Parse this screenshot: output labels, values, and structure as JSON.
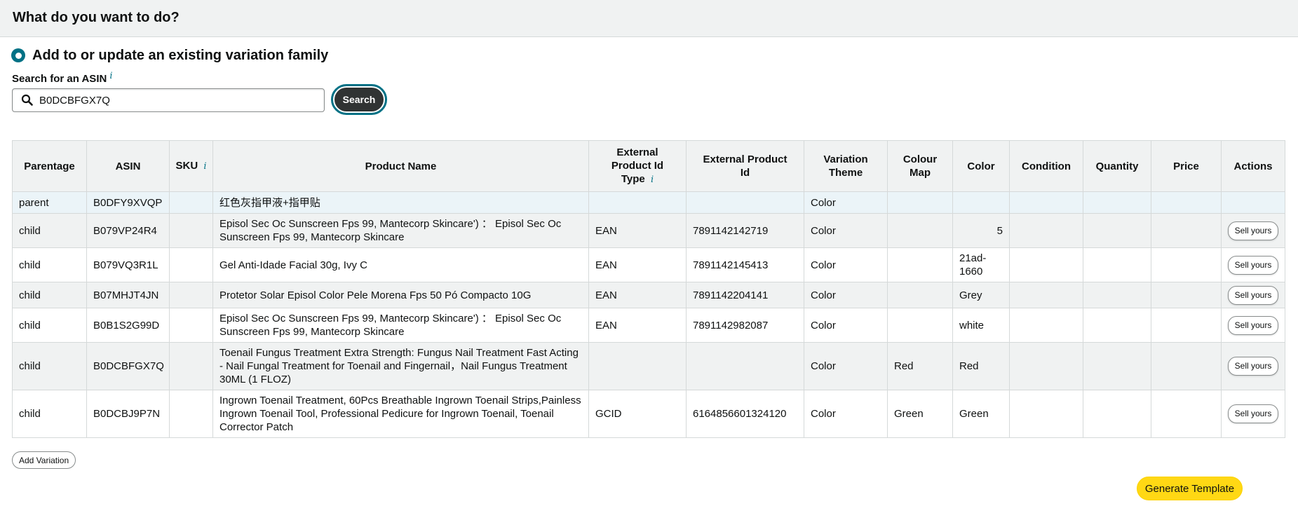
{
  "header": {
    "title": "What do you want to do?"
  },
  "option": {
    "label": "Add to or update an existing variation family",
    "selected": true
  },
  "search": {
    "label": "Search for an ASIN",
    "info_icon": "i",
    "value": "B0DCBFGX7Q",
    "button_label": "Search",
    "icon": "search-icon"
  },
  "table": {
    "headers": {
      "parentage": "Parentage",
      "asin": "ASIN",
      "sku": "SKU",
      "sku_info": "i",
      "product_name": "Product Name",
      "ext_id_type_1": "External",
      "ext_id_type_2": "Product Id",
      "ext_id_type_3": "Type",
      "ext_id_type_info": "i",
      "ext_id_1": "External Product",
      "ext_id_2": "Id",
      "variation_theme_1": "Variation",
      "variation_theme_2": "Theme",
      "colour_map_1": "Colour",
      "colour_map_2": "Map",
      "color": "Color",
      "condition": "Condition",
      "quantity": "Quantity",
      "price": "Price",
      "actions": "Actions"
    },
    "rows": [
      {
        "parentage": "parent",
        "asin": "B0DFY9XVQP",
        "sku": "",
        "product_name": "红色灰指甲液+指甲贴",
        "ext_id_type": "",
        "ext_id": "",
        "variation_theme": "Color",
        "colour_map": "",
        "color": "",
        "condition": "",
        "quantity": "",
        "price": "",
        "action": ""
      },
      {
        "parentage": "child",
        "asin": "B079VP24R4",
        "sku": "",
        "product_name": "Episol Sec Oc Sunscreen Fps 99, Mantecorp Skincare') ： Episol Sec Oc Sunscreen Fps 99, Mantecorp Skincare",
        "ext_id_type": "EAN",
        "ext_id": "7891142142719",
        "variation_theme": "Color",
        "colour_map": "",
        "color": "5",
        "condition": "",
        "quantity": "",
        "price": "",
        "action": "Sell yours"
      },
      {
        "parentage": "child",
        "asin": "B079VQ3R1L",
        "sku": "",
        "product_name": "Gel Anti-Idade Facial 30g, Ivy C",
        "ext_id_type": "EAN",
        "ext_id": "7891142145413",
        "variation_theme": "Color",
        "colour_map": "",
        "color": "21ad-1660",
        "condition": "",
        "quantity": "",
        "price": "",
        "action": "Sell yours"
      },
      {
        "parentage": "child",
        "asin": "B07MHJT4JN",
        "sku": "",
        "product_name": "Protetor Solar Episol Color Pele Morena Fps 50 Pó Compacto 10G",
        "ext_id_type": "EAN",
        "ext_id": "7891142204141",
        "variation_theme": "Color",
        "colour_map": "",
        "color": "Grey",
        "condition": "",
        "quantity": "",
        "price": "",
        "action": "Sell yours"
      },
      {
        "parentage": "child",
        "asin": "B0B1S2G99D",
        "sku": "",
        "product_name": "Episol Sec Oc Sunscreen Fps 99, Mantecorp Skincare') ： Episol Sec Oc Sunscreen Fps 99, Mantecorp Skincare",
        "ext_id_type": "EAN",
        "ext_id": "7891142982087",
        "variation_theme": "Color",
        "colour_map": "",
        "color": "white",
        "condition": "",
        "quantity": "",
        "price": "",
        "action": "Sell yours"
      },
      {
        "parentage": "child",
        "asin": "B0DCBFGX7Q",
        "sku": "",
        "product_name": "Toenail Fungus Treatment Extra Strength: Fungus Nail Treatment Fast Acting - Nail Fungal Treatment for Toenail and Fingernail，Nail Fungus Treatment 30ML (1 FLOZ)",
        "ext_id_type": "",
        "ext_id": "",
        "variation_theme": "Color",
        "colour_map": "Red",
        "color": "Red",
        "condition": "",
        "quantity": "",
        "price": "",
        "action": "Sell yours"
      },
      {
        "parentage": "child",
        "asin": "B0DCBJ9P7N",
        "sku": "",
        "product_name": "Ingrown Toenail Treatment, 60Pcs Breathable Ingrown Toenail Strips,Painless Ingrown Toenail Tool, Professional Pedicure for Ingrown Toenail, Toenail Corrector Patch",
        "ext_id_type": "GCID",
        "ext_id": "6164856601324120",
        "variation_theme": "Color",
        "colour_map": "Green",
        "color": "Green",
        "condition": "",
        "quantity": "",
        "price": "",
        "action": "Sell yours"
      }
    ]
  },
  "footer": {
    "add_variation": "Add Variation",
    "generate_template": "Generate Template"
  },
  "colors": {
    "accent": "#007185",
    "header_bg": "#f0f2f2",
    "parent_row_bg": "#ebf4f8",
    "primary_button": "#ffd814",
    "dark_button": "#303333"
  }
}
